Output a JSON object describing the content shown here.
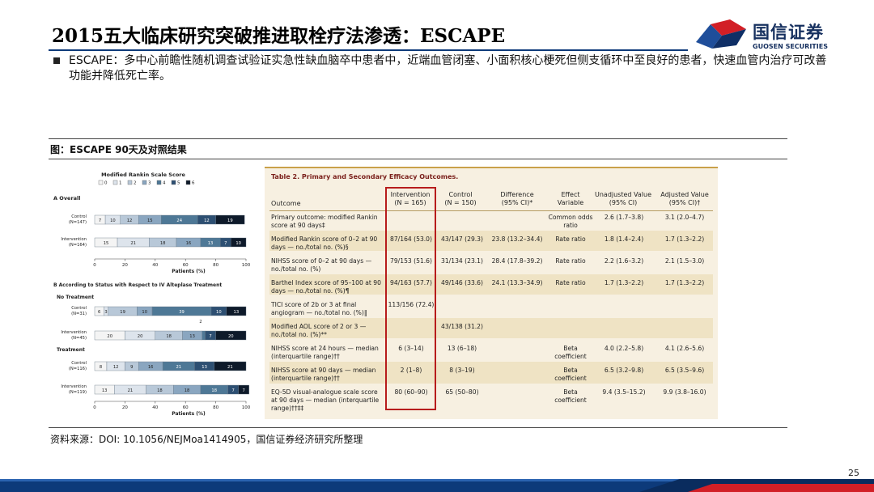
{
  "header": {
    "title": "2015五大临床研究突破推进取栓疗法渗透：ESCAPE",
    "logo_cn": "国信证券",
    "logo_en": "GUOSEN SECURITIES"
  },
  "bullet": {
    "text": "ESCAPE：多中心前瞻性随机调查试验证实急性缺血脑卒中患者中，近端血管闭塞、小面积核心梗死但侧支循环中至良好的患者，快速血管内治疗可改善功能并降低死亡率。"
  },
  "figure": {
    "label": "图：ESCAPE 90天及对照结果",
    "source": "资料来源：DOI: 10.1056/NEJMoa1414905，国信证券经济研究所整理"
  },
  "chart_data": {
    "type": "bar",
    "title": "Modified Rankin Scale Score",
    "legend": [
      "0",
      "1",
      "2",
      "3",
      "4",
      "5",
      "6"
    ],
    "colors": [
      "#f4f4f4",
      "#dde4ec",
      "#b8c8d8",
      "#8aa6c0",
      "#4e7896",
      "#2d4f72",
      "#0e1a2a"
    ],
    "xlabel": "Patients (%)",
    "xlim": [
      0,
      100
    ],
    "ticks": [
      "0",
      "20",
      "40",
      "60",
      "80",
      "100"
    ],
    "panel_a": "A Overall",
    "panel_b": "B According to Status with Respect to IV Alteplase Treatment",
    "group_no": "No Treatment",
    "group_yes": "Treatment",
    "extra_label": "2",
    "rows": [
      {
        "name": "Control",
        "n": "(N=147)",
        "values": [
          7,
          10,
          12,
          15,
          24,
          12,
          19
        ]
      },
      {
        "name": "Intervention",
        "n": "(N=164)",
        "values": [
          15,
          21,
          18,
          16,
          13,
          7,
          10
        ]
      },
      {
        "name": "Control",
        "n": "(N=31)",
        "values": [
          6,
          3,
          19,
          10,
          39,
          10,
          13
        ]
      },
      {
        "name": "Intervention",
        "n": "(N=45)",
        "values": [
          20,
          20,
          18,
          13,
          2,
          7,
          20
        ]
      },
      {
        "name": "Control",
        "n": "(N=116)",
        "values": [
          8,
          12,
          9,
          16,
          21,
          13,
          21
        ]
      },
      {
        "name": "Intervention",
        "n": "(N=119)",
        "values": [
          13,
          21,
          18,
          18,
          18,
          7,
          7
        ]
      }
    ]
  },
  "table": {
    "title": "Table 2. Primary and Secondary Efficacy Outcomes.",
    "headers": {
      "outcome": "Outcome",
      "intervention": "Intervention\n(N = 165)",
      "control": "Control\n(N = 150)",
      "difference": "Difference\n(95% CI)*",
      "effect": "Effect\nVariable",
      "unadjusted": "Unadjusted Value\n(95% CI)",
      "adjusted": "Adjusted Value\n(95% CI)†"
    },
    "rows": [
      {
        "outcome": "Primary outcome: modified Rankin score at 90 days‡",
        "intervention": "",
        "control": "",
        "difference": "",
        "effect": "Common odds ratio",
        "unadjusted": "2.6 (1.7–3.8)",
        "adjusted": "3.1 (2.0–4.7)"
      },
      {
        "outcome": "Modified Rankin score of 0–2 at 90 days — no./total no. (%)§",
        "intervention": "87/164 (53.0)",
        "control": "43/147 (29.3)",
        "difference": "23.8 (13.2–34.4)",
        "effect": "Rate ratio",
        "unadjusted": "1.8 (1.4–2.4)",
        "adjusted": "1.7 (1.3–2.2)"
      },
      {
        "outcome": "NIHSS score of 0–2 at 90 days — no./total no. (%)",
        "intervention": "79/153 (51.6)",
        "control": "31/134 (23.1)",
        "difference": "28.4 (17.8–39.2)",
        "effect": "Rate ratio",
        "unadjusted": "2.2 (1.6–3.2)",
        "adjusted": "2.1 (1.5–3.0)"
      },
      {
        "outcome": "Barthel Index score of 95–100 at 90 days — no./total no. (%)¶",
        "intervention": "94/163 (57.7)",
        "control": "49/146 (33.6)",
        "difference": "24.1 (13.3–34.9)",
        "effect": "Rate ratio",
        "unadjusted": "1.7 (1.3–2.2)",
        "adjusted": "1.7 (1.3–2.2)"
      },
      {
        "outcome": "TICI score of 2b or 3 at final angiogram — no./total no. (%)‖",
        "intervention": "113/156 (72.4)",
        "control": "",
        "difference": "",
        "effect": "",
        "unadjusted": "",
        "adjusted": ""
      },
      {
        "outcome": "Modified AOL score of 2 or 3 — no./total no. (%)**",
        "intervention": "",
        "control": "43/138 (31.2)",
        "difference": "",
        "effect": "",
        "unadjusted": "",
        "adjusted": ""
      },
      {
        "outcome": "NIHSS score at 24 hours — median (interquartile range)††",
        "intervention": "6 (3–14)",
        "control": "13 (6–18)",
        "difference": "",
        "effect": "Beta coefficient",
        "unadjusted": "4.0 (2.2–5.8)",
        "adjusted": "4.1 (2.6–5.6)"
      },
      {
        "outcome": "NIHSS score at 90 days — median (interquartile range)††",
        "intervention": "2 (1–8)",
        "control": "8 (3–19)",
        "difference": "",
        "effect": "Beta coefficient",
        "unadjusted": "6.5 (3.2–9.8)",
        "adjusted": "6.5 (3.5–9.6)"
      },
      {
        "outcome": "EQ-5D visual-analogue scale score at 90 days — median (interquartile range)††‡‡",
        "intervention": "80 (60–90)",
        "control": "65 (50–80)",
        "difference": "",
        "effect": "Beta coefficient",
        "unadjusted": "9.4 (3.5–15.2)",
        "adjusted": "9.9 (3.8–16.0)"
      }
    ]
  },
  "page": {
    "number": "25"
  },
  "colors": {
    "navy": "#0d3a7a",
    "red": "#d21f26",
    "accent_blue": "#1f63b7"
  }
}
